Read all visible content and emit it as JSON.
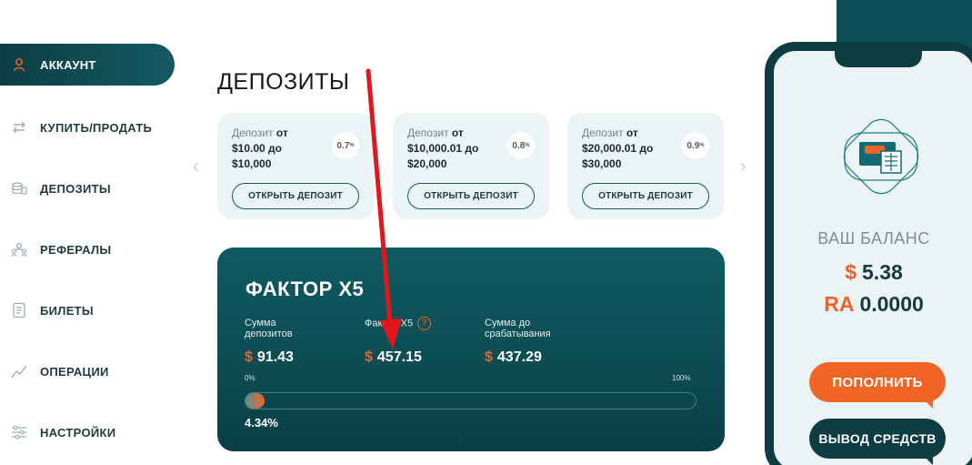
{
  "sidebar": {
    "items": [
      {
        "label": "АККАУНТ",
        "icon": "user-icon",
        "active": true
      },
      {
        "label": "КУПИТЬ/ПРОДАТЬ",
        "icon": "exchange-icon",
        "active": false
      },
      {
        "label": "ДЕПОЗИТЫ",
        "icon": "coins-icon",
        "active": false
      },
      {
        "label": "РЕФЕРАЛЫ",
        "icon": "referrals-icon",
        "active": false
      },
      {
        "label": "БИЛЕТЫ",
        "icon": "ticket-icon",
        "active": false
      },
      {
        "label": "ОПЕРАЦИИ",
        "icon": "chart-line-icon",
        "active": false
      },
      {
        "label": "НАСТРОЙКИ",
        "icon": "sliders-icon",
        "active": false
      }
    ]
  },
  "deposits": {
    "title": "ДЕПОЗИТЫ",
    "cards": [
      {
        "word_deposit": "Депозит",
        "word_from": "от",
        "min": "$10.00",
        "word_to": "до",
        "max": "$10,000",
        "rate": "0.7",
        "rate_unit": "%",
        "button": "ОТКРЫТЬ ДЕПОЗИТ"
      },
      {
        "word_deposit": "Депозит",
        "word_from": "от",
        "min": "$10,000.01",
        "word_to": "до",
        "max": "$20,000",
        "rate": "0.8",
        "rate_unit": "%",
        "button": "ОТКРЫТЬ ДЕПОЗИТ"
      },
      {
        "word_deposit": "Депозит",
        "word_from": "от",
        "min": "$20,000.01",
        "word_to": "до",
        "max": "$30,000",
        "rate": "0.9",
        "rate_unit": "%",
        "button": "ОТКРЫТЬ ДЕПОЗИТ"
      }
    ]
  },
  "factor": {
    "title": "ФАКТОР X5",
    "currency": "$",
    "deposits_sum_label_1": "Сумма",
    "deposits_sum_label_2": "депозитов",
    "deposits_sum_value": "91.43",
    "factor_label": "Фактор X5",
    "help": "?",
    "factor_value": "457.15",
    "trigger_label_1": "Сумма до",
    "trigger_label_2": "срабатывания",
    "trigger_value": "437.29",
    "progress_min": "0%",
    "progress_max": "100%",
    "progress_text": "4.34%",
    "progress_percent": 4.34
  },
  "balance": {
    "label": "ВАШ БАЛАНС",
    "usd_currency": "$",
    "usd_value": "5.38",
    "ra_currency": "RA",
    "ra_value": "0.0000",
    "topup_button": "ПОПОЛНИТЬ",
    "withdraw_button": "ВЫВОД СРЕДСТВ"
  },
  "colors": {
    "accent": "#f0632a",
    "brand_dark": "#0d3c43",
    "card_bg": "#eaf4f5"
  }
}
